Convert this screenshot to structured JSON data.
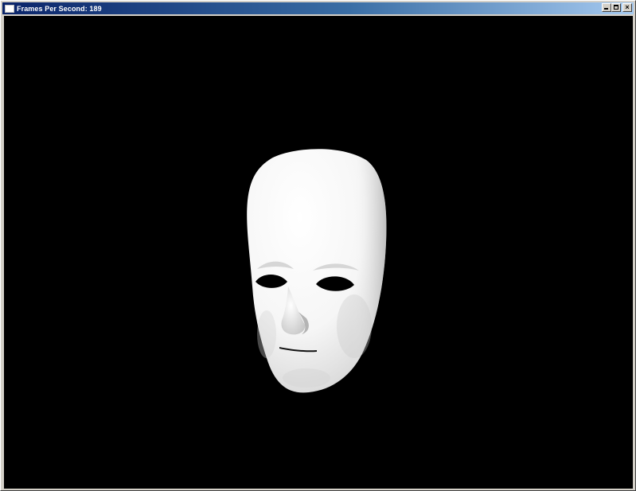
{
  "window": {
    "title": "Frames Per Second: 189",
    "close_glyph": "×",
    "icons": {
      "app": "app-window-icon",
      "minimize": "minimize-icon",
      "maximize": "maximize-icon",
      "close": "close-icon"
    }
  },
  "colors": {
    "titlebar_start": "#0a246a",
    "titlebar_end": "#a6caf0",
    "frame": "#d4d0c8",
    "viewport_bg": "#000000",
    "model": "#ffffff"
  }
}
